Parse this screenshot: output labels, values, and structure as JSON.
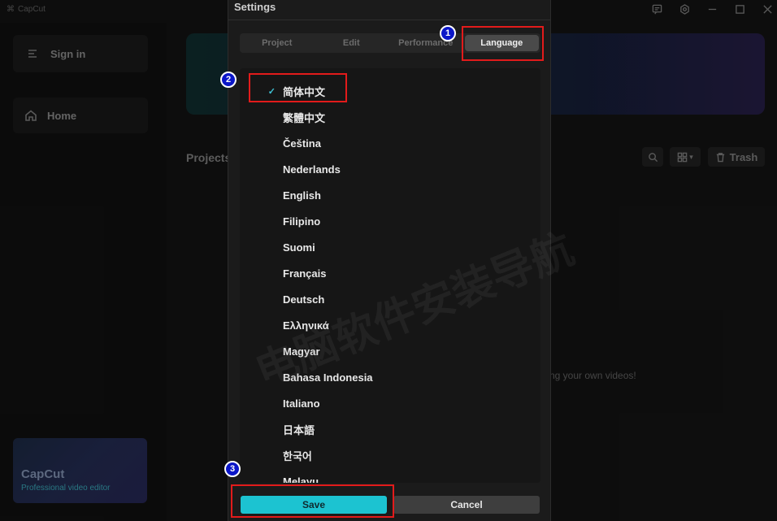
{
  "app": {
    "logo_text": "CapCut",
    "promo_title": "CapCut",
    "promo_subtitle": "Professional video editor"
  },
  "sidebar": {
    "sign_in": "Sign in",
    "home": "Home"
  },
  "main": {
    "projects_label": "Projects",
    "trash_label": "Trash",
    "empty_hint": "ng your own videos!"
  },
  "dialog": {
    "title": "Settings",
    "tabs": [
      "Project",
      "Edit",
      "Performance",
      "Language"
    ],
    "active_tab": "Language",
    "selected_language": "简体中文",
    "languages": [
      "简体中文",
      "繁體中文",
      "Čeština",
      "Nederlands",
      "English",
      "Filipino",
      "Suomi",
      "Français",
      "Deutsch",
      "Ελληνικά",
      "Magyar",
      "Bahasa Indonesia",
      "Italiano",
      "日本語",
      "한국어",
      "Melayu"
    ],
    "save_label": "Save",
    "cancel_label": "Cancel"
  },
  "annotations": {
    "markers": [
      "1",
      "2",
      "3"
    ],
    "highlight_color": "#e21b1b",
    "marker_color": "#0b16c8"
  },
  "watermark": "电脑软件安装导航"
}
